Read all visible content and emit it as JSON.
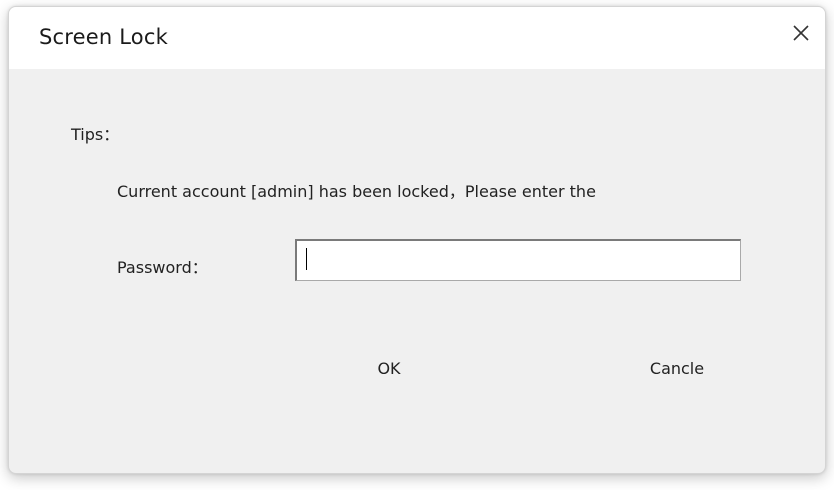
{
  "dialog": {
    "title": "Screen Lock",
    "close_icon": "close-icon"
  },
  "tips": {
    "label": "Tips：",
    "message": "Current account [admin] has been locked，Please enter the"
  },
  "password": {
    "label": "Password：",
    "value": "",
    "placeholder": ""
  },
  "buttons": {
    "ok_label": "OK",
    "cancel_label": "Cancle"
  }
}
